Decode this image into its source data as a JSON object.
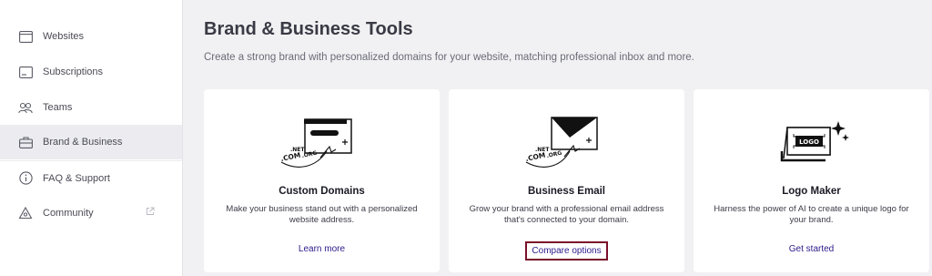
{
  "sidebar": {
    "items": [
      {
        "label": "Websites",
        "icon": "browser-window-icon"
      },
      {
        "label": "Subscriptions",
        "icon": "card-icon"
      },
      {
        "label": "Teams",
        "icon": "people-icon"
      },
      {
        "label": "Brand & Business",
        "icon": "briefcase-icon",
        "active": true
      },
      {
        "label": "FAQ & Support",
        "icon": "info-icon"
      },
      {
        "label": "Community",
        "icon": "community-icon",
        "external": true
      }
    ]
  },
  "header": {
    "title": "Brand & Business Tools",
    "subtitle": "Create a strong brand with personalized domains for your website, matching professional inbox and more."
  },
  "cards": [
    {
      "title": "Custom Domains",
      "description": "Make your business stand out with a personalized website address.",
      "link": "Learn more",
      "illustration_text": [
        ".NET",
        ".COM",
        ".ORG"
      ]
    },
    {
      "title": "Business Email",
      "description": "Grow your brand with a professional email address that's connected to your domain.",
      "link": "Compare options",
      "highlighted": true,
      "illustration_text": [
        ".NET",
        ".COM",
        ".ORG"
      ]
    },
    {
      "title": "Logo Maker",
      "description": "Harness the power of AI to create a unique logo for your brand.",
      "link": "Get started",
      "illustration_text": [
        "LOGO"
      ]
    }
  ],
  "colors": {
    "accent_link": "#2b1a8a",
    "highlight_border": "#7a0f2a",
    "background": "#f1f1f3"
  }
}
